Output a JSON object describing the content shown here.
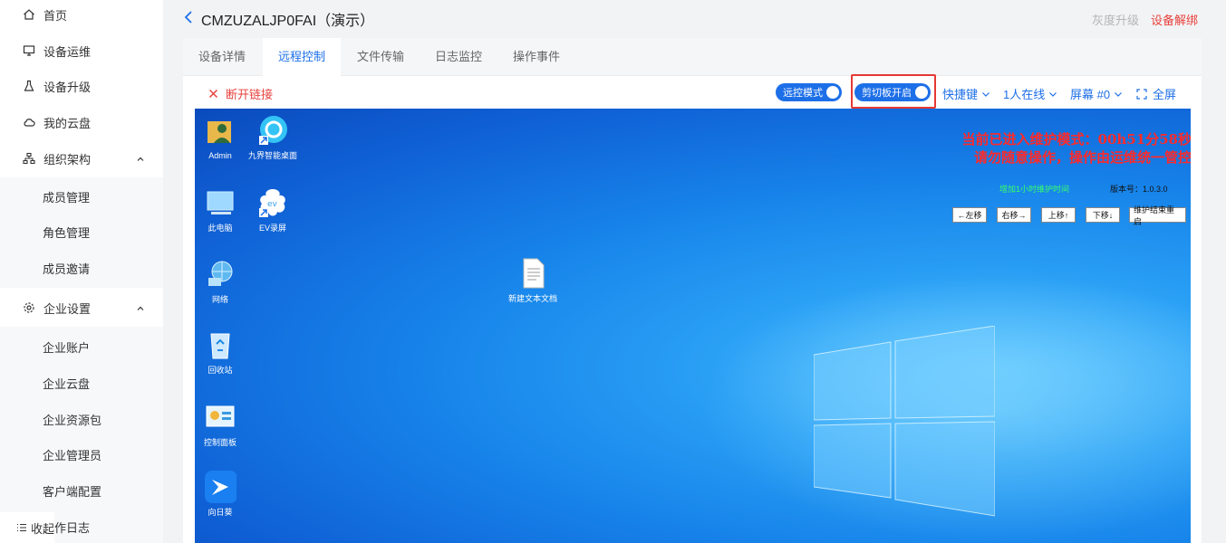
{
  "sidebar": {
    "items": [
      {
        "label": "首页"
      },
      {
        "label": "设备运维"
      },
      {
        "label": "设备升级"
      },
      {
        "label": "我的云盘"
      },
      {
        "label": "组织架构"
      },
      {
        "label": "企业设置"
      }
    ],
    "org_children": [
      "成员管理",
      "角色管理",
      "成员邀请"
    ],
    "ent_children": [
      "企业账户",
      "企业云盘",
      "企业资源包",
      "企业管理员",
      "客户端配置",
      "操作日志"
    ],
    "collapse_label": "收起"
  },
  "header": {
    "title": "CMZUZALJP0FAI（演示）",
    "gray_link": "灰度升级",
    "red_link": "设备解绑"
  },
  "tabs": [
    "设备详情",
    "远程控制",
    "文件传输",
    "日志监控",
    "操作事件"
  ],
  "active_tab": "远程控制",
  "toolbar": {
    "disconnect": "断开链接",
    "remote_mode": "远控模式",
    "clipboard": "剪切板开启",
    "shortcut": "快捷键",
    "online": "1人在线",
    "screen": "屏幕 #0",
    "fullscreen": "全屏"
  },
  "desktop": {
    "icons": [
      {
        "label": "Admin"
      },
      {
        "label": "九界智能桌面"
      },
      {
        "label": "此电脑"
      },
      {
        "label": "EV录屏"
      },
      {
        "label": "网络"
      },
      {
        "label": "新建文本文档"
      },
      {
        "label": "回收站"
      },
      {
        "label": "控制面板"
      },
      {
        "label": "向日葵"
      }
    ],
    "overlay": {
      "line1": "当前已进入维护模式：00h51分58秒",
      "line2": "请勿随意操作，操作由运维统一管控",
      "extend": "增加1小时维护时间",
      "version": "版本号：1.0.3.0",
      "buttons": [
        "←左移",
        "右移→",
        "上移↑",
        "下移↓",
        "维护结束重启"
      ]
    }
  },
  "colors": {
    "accent": "#1d6fe8",
    "danger": "#e8423d",
    "highlight": "#e53935"
  }
}
